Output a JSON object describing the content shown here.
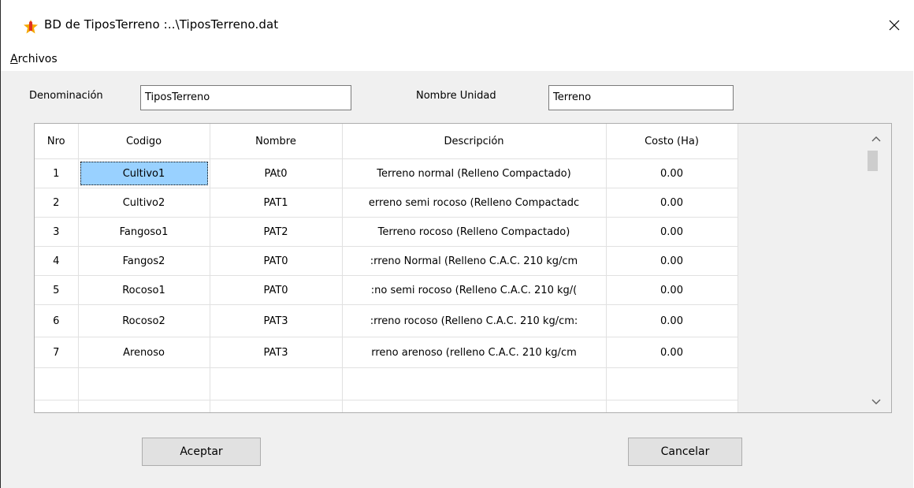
{
  "window": {
    "title": "BD de  TiposTerreno :..\\TiposTerreno.dat",
    "close_label": "✕"
  },
  "menu": {
    "items": [
      {
        "label": "Archivos"
      }
    ]
  },
  "form": {
    "denominacion_label": "Denominación",
    "denominacion_value": "TiposTerreno",
    "nombre_unidad_label": "Nombre Unidad",
    "nombre_unidad_value": "Terreno"
  },
  "grid": {
    "columns": [
      "Nro",
      "Codigo",
      "Nombre",
      "Descripción",
      "Costo (Ha)"
    ],
    "rows": [
      {
        "nro": "1",
        "codigo": "Cultivo1",
        "nombre": "PAt0",
        "descripcion": "Terreno normal (Relleno Compactado)",
        "costo": "0.00"
      },
      {
        "nro": "2",
        "codigo": "Cultivo2",
        "nombre": "PAT1",
        "descripcion": "erreno semi rocoso (Relleno Compactadc",
        "costo": "0.00"
      },
      {
        "nro": "3",
        "codigo": "Fangoso1",
        "nombre": "PAT2",
        "descripcion": "Terreno rocoso (Relleno Compactado)",
        "costo": "0.00"
      },
      {
        "nro": "4",
        "codigo": "Fangos2",
        "nombre": "PAT0",
        "descripcion": ":rreno Normal (Relleno C.A.C. 210 kg/cm",
        "costo": "0.00"
      },
      {
        "nro": "5",
        "codigo": "Rocoso1",
        "nombre": "PAT0",
        "descripcion": ":no semi rocoso (Relleno C.A.C. 210 kg/(",
        "costo": "0.00"
      },
      {
        "nro": "6",
        "codigo": "Rocoso2",
        "nombre": "PAT3",
        "descripcion": ":rreno rocoso (Relleno C.A.C. 210 kg/cm:",
        "costo": "0.00"
      },
      {
        "nro": "7",
        "codigo": "Arenoso",
        "nombre": "PAT3",
        "descripcion": "rreno arenoso (relleno C.A.C. 210 kg/cm",
        "costo": "0.00"
      }
    ],
    "selected_cell": "Cultivo1"
  },
  "buttons": {
    "accept_label": "Aceptar",
    "cancel_label": "Cancelar"
  },
  "colors": {
    "selection": "#99d1ff",
    "window_bg": "#f0f0f0",
    "icon_star": "#f5a800",
    "icon_figure": "#e03020"
  }
}
